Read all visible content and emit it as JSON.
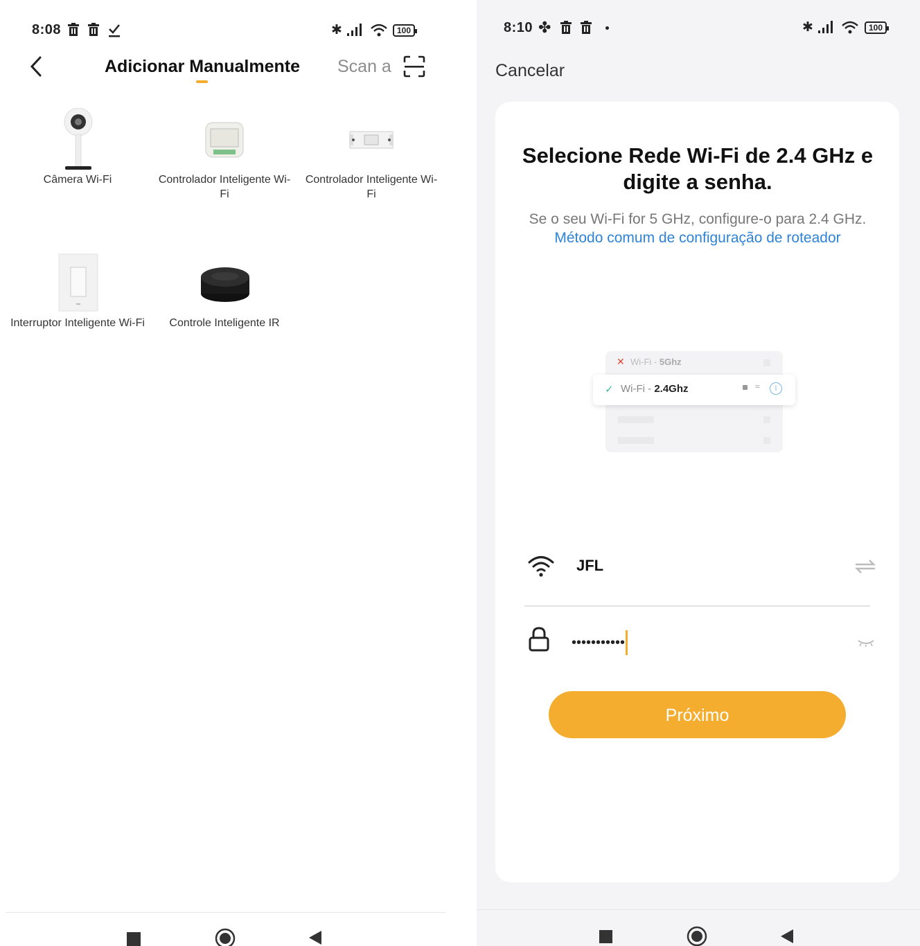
{
  "left": {
    "status": {
      "time": "8:08",
      "battery": "100"
    },
    "header": {
      "title": "Adicionar Manualmente",
      "scan_label": "Scan a"
    },
    "devices": [
      {
        "label": "Câmera Wi-Fi",
        "icon": "camera-icon"
      },
      {
        "label": "Controlador Inteligente Wi-Fi",
        "icon": "smart-controller-module-icon"
      },
      {
        "label": "Controlador Inteligente Wi-Fi",
        "icon": "smart-relay-icon"
      },
      {
        "label": "Interruptor Inteligente Wi-Fi",
        "icon": "wall-switch-icon"
      },
      {
        "label": "Controle Inteligente IR",
        "icon": "ir-hub-icon"
      }
    ],
    "accent_color": "#f5ad30"
  },
  "right": {
    "status": {
      "time": "8:10",
      "battery": "100"
    },
    "cancel_label": "Cancelar",
    "heading": "Selecione Rede Wi-Fi de 2.4 GHz e digite a senha.",
    "subtitle_plain": "Se o seu Wi-Fi for 5 GHz, configure-o para 2.4 GHz. ",
    "subtitle_link": "Método comum de configuração de roteador",
    "illustration": {
      "row_5g_prefix": "Wi-Fi - ",
      "row_5g_band": "5Ghz",
      "row_24g_prefix": "Wi-Fi - ",
      "row_24g_band": "2.4Ghz"
    },
    "wifi_name": "JFL",
    "password_value": "•••••••••••",
    "next_button": "Próximo",
    "link_color": "#2e83d6",
    "button_color": "#f5ad30"
  }
}
